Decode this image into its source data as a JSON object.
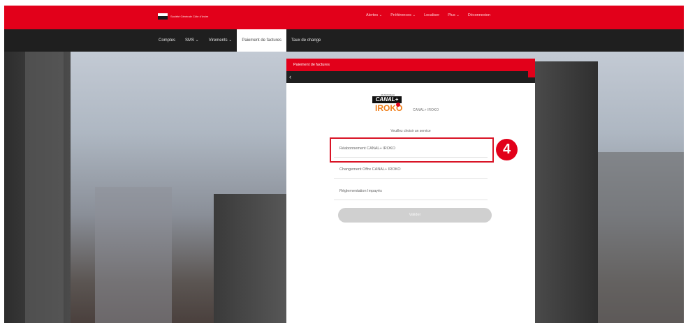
{
  "topbar": {
    "bank_name": "Société Générale Côte d'Ivoire",
    "menu": [
      "Alertes ⌄",
      "Préférences ⌄",
      "Localiser",
      "Plus ⌄",
      "Déconnexion"
    ]
  },
  "subnav": {
    "items": [
      "Comptes",
      "SMS ⌄",
      "Virements ⌄",
      "Paiement de factures",
      "Taux de change"
    ],
    "active_index": 3
  },
  "modal": {
    "title": "Paiement de factures",
    "brand": {
      "top_text": "UN NOUVEAU",
      "canal": "CANAL+",
      "iroko": "IROKO"
    },
    "brand_label": "CANAL+ IROKO",
    "select_label": "Veuillez choisir un service",
    "options": [
      "Réabonnement CANAL+ IROKO",
      "Changement Offre CANAL+ IROKO",
      "Réglementation Impayés"
    ],
    "submit_label": "Valider"
  },
  "annotation": {
    "step": "4",
    "highlight_color": "#d91426"
  },
  "colors": {
    "brand_red": "#e2001a",
    "dark_nav": "#1f1f1f",
    "iroko_orange": "#f07f1a"
  }
}
